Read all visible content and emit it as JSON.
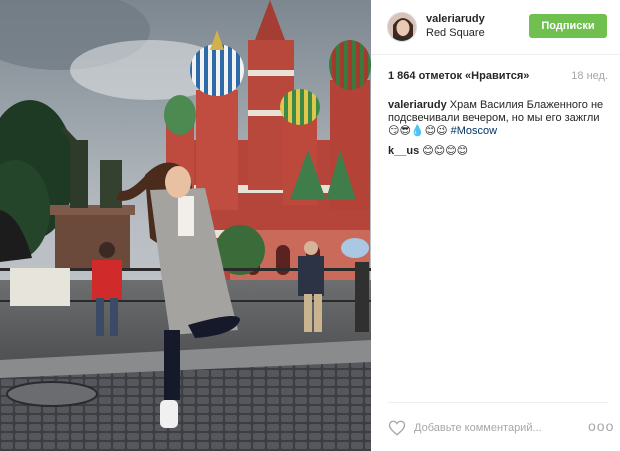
{
  "post": {
    "username": "valeriarudy",
    "location": "Red Square",
    "follow_label": "Подписки",
    "likes": "1 864 отметок «Нравится»",
    "timestamp": "18 нед.",
    "caption_user": "valeriarudy",
    "caption_text": "Храм Василия Блаженного не подсвечивали вечером, но мы его зажгли😏😎💧😊😉",
    "caption_hashtag": "#Moscow",
    "comments": [
      {
        "user": "k__us",
        "text": "😊😊😊😊"
      }
    ],
    "comment_placeholder": "Добавьте комментарий...",
    "more_symbol": "ooo"
  },
  "colors": {
    "follow_button": "#70c050",
    "hashtag": "#003569",
    "muted_text": "#a5a7aa"
  },
  "icons": {
    "like": "heart-icon",
    "more": "more-options-icon"
  }
}
